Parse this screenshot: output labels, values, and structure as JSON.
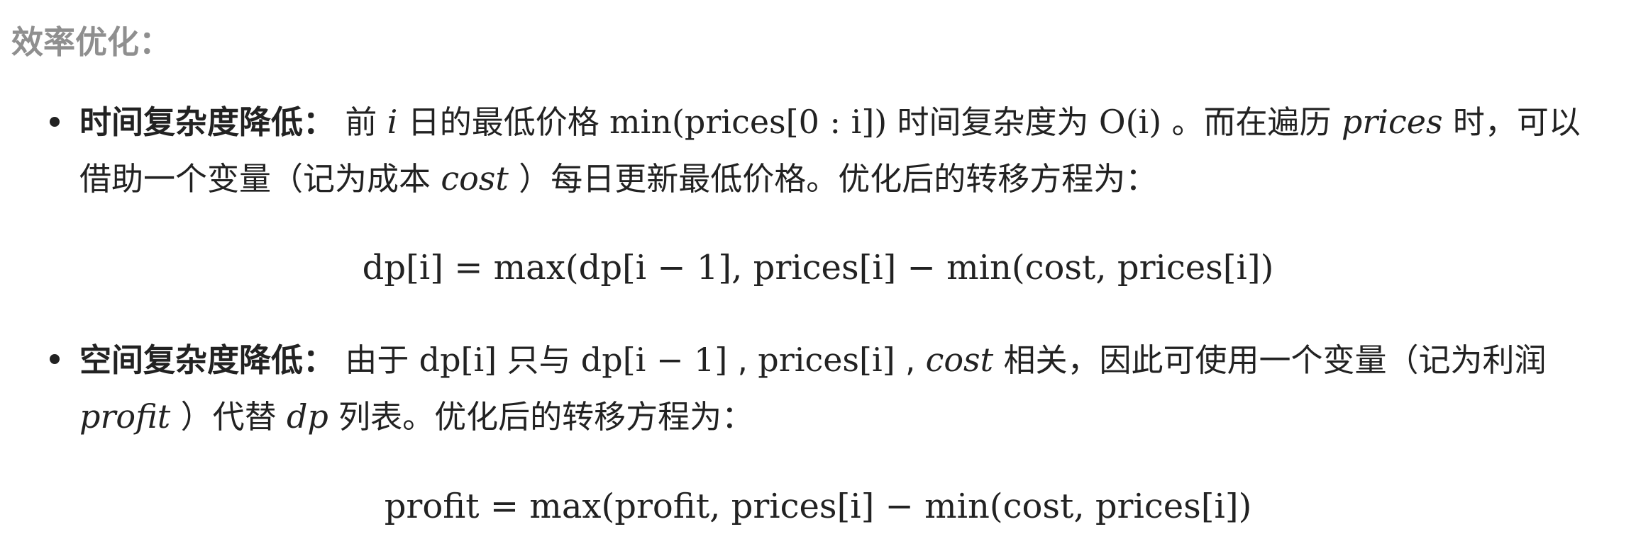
{
  "section": {
    "title": "效率优化："
  },
  "items": [
    {
      "lead": "时间复杂度降低：",
      "line1": {
        "t1": "前",
        "m1": "i",
        "t2": "日的最低价格",
        "m2": "min(prices[0 : i])",
        "t3": "时间复杂度为",
        "m3": "O(i)",
        "t4": "。而在遍历",
        "m4": "prices",
        "t5": "时，可以"
      },
      "line2": {
        "t1": "借助一个变量（记为成本",
        "m1": "cost",
        "t2": "）每日更新最低价格。优化后的转移方程为："
      },
      "equation": "dp[i] = max(dp[i − 1], prices[i] − min(cost, prices[i])"
    },
    {
      "lead": "空间复杂度降低：",
      "line1": {
        "t1": "由于",
        "m1": "dp[i]",
        "t2": "只与",
        "m2": "dp[i − 1]",
        "t3": ",",
        "m3": "prices[i]",
        "t4": ",",
        "m4": "cost",
        "t5": "相关，因此可使用一个变量（记为利润"
      },
      "line2": {
        "m1": "profit",
        "t1": "）代替",
        "m2": "dp",
        "t2": "列表。优化后的转移方程为："
      },
      "equation": "profit = max(profit, prices[i] − min(cost, prices[i])"
    }
  ]
}
